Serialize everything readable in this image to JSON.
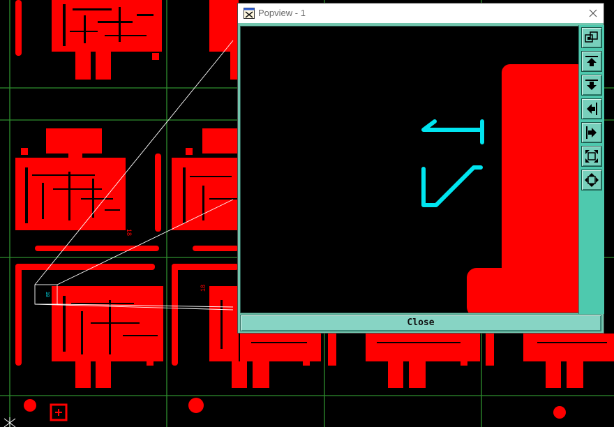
{
  "popview": {
    "title": "Popview - 1",
    "close_label": "Close",
    "toolbar": [
      {
        "name": "zoom-window-button",
        "icon": "zoom-window-icon"
      },
      {
        "name": "pan-up-button",
        "icon": "arrow-up-icon"
      },
      {
        "name": "pan-down-button",
        "icon": "arrow-down-icon"
      },
      {
        "name": "pan-left-button",
        "icon": "arrow-left-icon"
      },
      {
        "name": "pan-right-button",
        "icon": "arrow-right-icon"
      },
      {
        "name": "zoom-out-button",
        "icon": "zoom-out-icon"
      },
      {
        "name": "zoom-in-button",
        "icon": "zoom-in-icon"
      }
    ]
  },
  "board": {
    "silkscreen_labels": [
      "18",
      "18",
      "18"
    ]
  },
  "colors": {
    "copper": "#ff0000",
    "silkscreen": "#00e5f0",
    "grid": "#2f8f2f",
    "background": "#000000",
    "frame": "#73c6ae"
  }
}
